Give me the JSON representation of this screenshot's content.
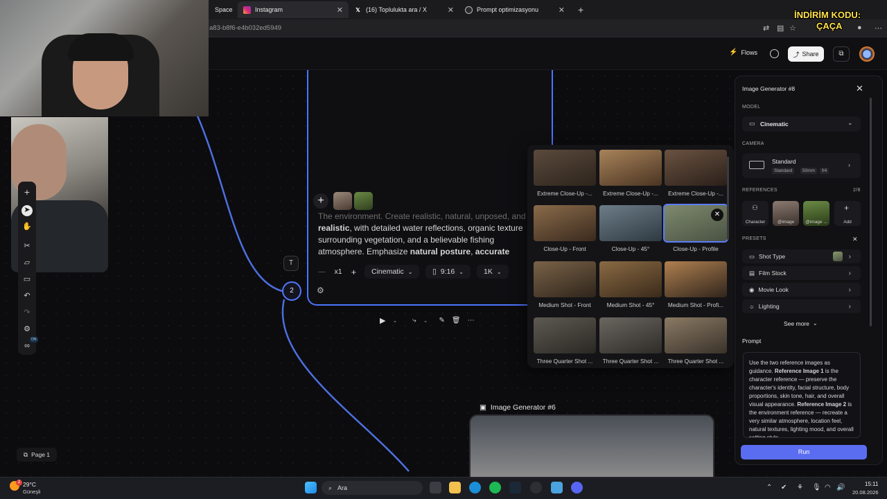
{
  "browser": {
    "tabs": [
      {
        "label": "Space"
      },
      {
        "label": "Instagram"
      },
      {
        "label": "(16) Toplulukta ara / X"
      },
      {
        "label": "Prompt optimizasyonu"
      }
    ],
    "url_fragment": "a83-b8f6-e4b032ed5949",
    "overlay_promo_line1": "İNDİRİM KODU:",
    "overlay_promo_line2": "ÇAÇA"
  },
  "topbar": {
    "flows_label": "Flows",
    "share_label": "Share"
  },
  "node": {
    "number": "2",
    "prompt_faded": "The environment. Create realistic, natural, unposed, and",
    "prompt_bold_1": "realistic",
    "prompt_mid_1": ", with detailed water reflections, organic texture surrounding vegetation, and a believable fishing atmosphere. Emphasize ",
    "prompt_bold_2": "natural posture",
    "prompt_mid_2": ", ",
    "prompt_bold_3": "accurate",
    "count_label": "x1",
    "style_label": "Cinematic",
    "ratio_label": "9:16",
    "resolution_label": "1K"
  },
  "shot_types": [
    {
      "label": "Extreme Close-Up -...",
      "tone": [
        "#5a4a3c",
        "#2d241c"
      ]
    },
    {
      "label": "Extreme Close-Up -...",
      "tone": [
        "#a8835a",
        "#4a3422"
      ]
    },
    {
      "label": "Extreme Close-Up -...",
      "tone": [
        "#6b5240",
        "#2a201a"
      ]
    },
    {
      "label": "Close-Up - Front",
      "tone": [
        "#8a6b4a",
        "#3a2a1e"
      ]
    },
    {
      "label": "Close-Up - 45°",
      "tone": [
        "#6d7d88",
        "#2f3a42"
      ]
    },
    {
      "label": "Close-Up - Profile",
      "tone": [
        "#7e8a6e",
        "#4a5242"
      ]
    },
    {
      "label": "Medium Shot - Front",
      "tone": [
        "#7a6248",
        "#2f251b"
      ]
    },
    {
      "label": "Medium Shot - 45°",
      "tone": [
        "#8a6a44",
        "#3a2a1a"
      ]
    },
    {
      "label": "Medium Shot - Profi...",
      "tone": [
        "#b08050",
        "#30251c"
      ]
    },
    {
      "label": "Three Quarter Shot ...",
      "tone": [
        "#5e5a52",
        "#2a2824"
      ]
    },
    {
      "label": "Three Quarter Shot ...",
      "tone": [
        "#6a6660",
        "#2e2c28"
      ]
    },
    {
      "label": "Three Quarter Shot ...",
      "tone": [
        "#8a7a64",
        "#3a322a"
      ]
    }
  ],
  "ig6": {
    "title": "Image Generator #6"
  },
  "page": {
    "label": "Page 1"
  },
  "panel": {
    "title": "Image Generator #8",
    "model_label": "MODEL",
    "model_value": "Cinematic",
    "camera_label": "CAMERA",
    "camera_value": "Standard",
    "camera_tags": [
      "Standard",
      "50mm",
      "f/4"
    ],
    "references_label": "REFERENCES",
    "references_count": "2/8",
    "ref_slots": [
      {
        "label": "Character"
      },
      {
        "label": "@image"
      },
      {
        "label": "@image ..."
      },
      {
        "label": "Add"
      }
    ],
    "presets_label": "PRESETS",
    "presets": [
      {
        "label": "Shot Type"
      },
      {
        "label": "Film Stock"
      },
      {
        "label": "Movie Look"
      },
      {
        "label": "Lighting"
      }
    ],
    "see_more": "See more",
    "prompt_heading": "Prompt",
    "prompt_parts": {
      "p1": "Use the two reference images as guidance. ",
      "b1": "Reference Image 1",
      "p2": " is the character reference — preserve the character's identity, facial structure, body proportions, skin tone, hair, and overall visual appearance. ",
      "b2": "Reference Image 2",
      "p3": " is the environment reference — recreate a very similar atmosphere, location feel, natural textures, lighting mood, and overall setting style."
    },
    "run_label": "Run"
  },
  "taskbar": {
    "weather_badge": "2",
    "temperature": "29°C",
    "weather_desc": "Güneşli",
    "search_placeholder": "Ara",
    "time": "15:11",
    "date": "20.08.2026"
  },
  "toolbar_on_badge": "ON",
  "colors": {
    "accent": "#4d74ff",
    "run_button": "#5a6cf0",
    "promo_text": "#ffe14a"
  }
}
